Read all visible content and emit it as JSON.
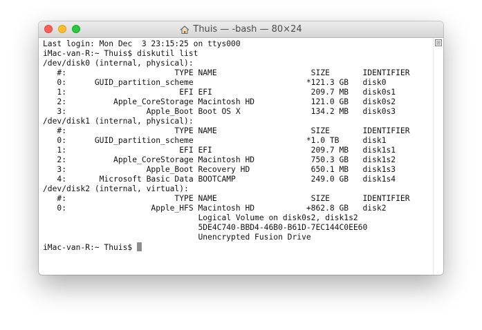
{
  "window": {
    "title": "Thuis — -bash — 80×24",
    "icon": "home-icon"
  },
  "terminal": {
    "lines": [
      "Last login: Mon Dec  3 23:15:25 on ttys000",
      "iMac-van-R:~ Thuis$ diskutil list",
      "/dev/disk0 (internal, physical):",
      "   #:                       TYPE NAME                    SIZE       IDENTIFIER",
      "   0:      GUID_partition_scheme                        *121.3 GB   disk0",
      "   1:                        EFI EFI                     209.7 MB   disk0s1",
      "   2:          Apple_CoreStorage Macintosh HD            121.0 GB   disk0s2",
      "   3:                 Apple_Boot Boot OS X               134.2 MB   disk0s3",
      "/dev/disk1 (internal, physical):",
      "   #:                       TYPE NAME                    SIZE       IDENTIFIER",
      "   0:      GUID_partition_scheme                        *1.0 TB     disk1",
      "   1:                        EFI EFI                     209.7 MB   disk1s1",
      "   2:          Apple_CoreStorage Macintosh HD            750.3 GB   disk1s2",
      "   3:                 Apple_Boot Recovery HD             650.1 MB   disk1s3",
      "   4:       Microsoft Basic Data BOOTCAMP                249.0 GB   disk1s4",
      "/dev/disk2 (internal, virtual):",
      "   #:                       TYPE NAME                    SIZE       IDENTIFIER",
      "   0:                  Apple_HFS Macintosh HD           +862.8 GB   disk2",
      "                                 Logical Volume on disk0s2, disk1s2",
      "                                 5DE4C740-BBD4-46B0-B61D-7EC144C0EE60",
      "                                 Unencrypted Fusion Drive"
    ],
    "prompt": "iMac-van-R:~ Thuis$ "
  },
  "colors": {
    "close": "#fd5f57",
    "minimize": "#febc2e",
    "zoom": "#29c840"
  }
}
